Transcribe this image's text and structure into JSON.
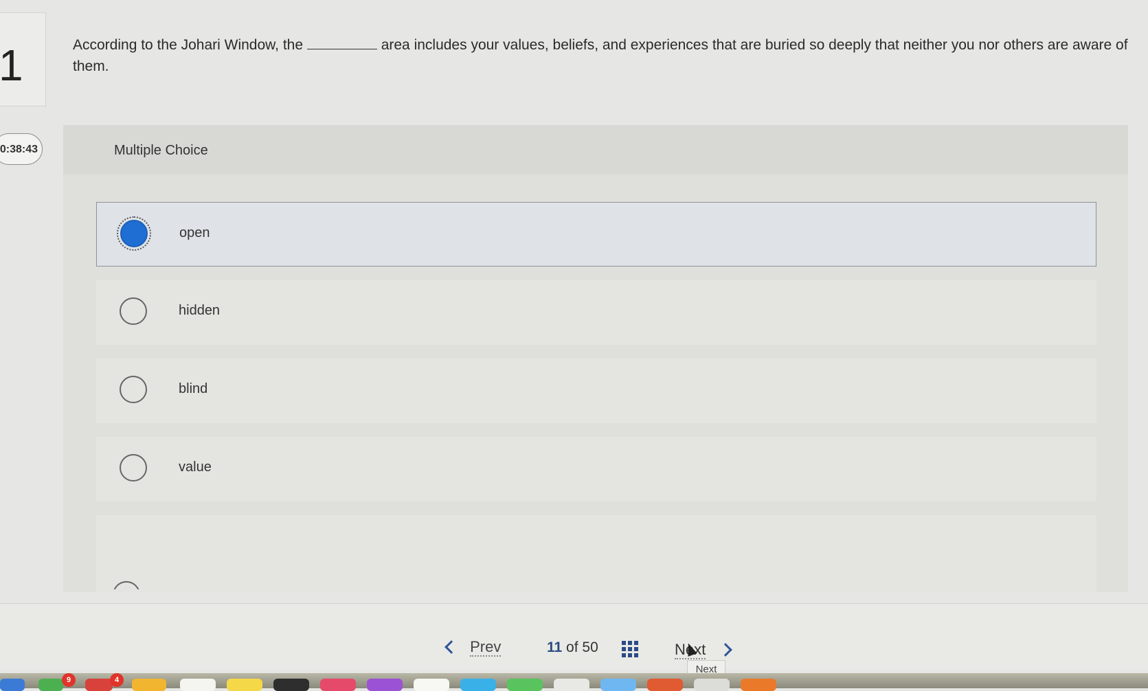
{
  "question": {
    "number": "1",
    "text_before": "According to the Johari Window, the",
    "text_after": "area includes your values, beliefs, and experiences that are buried so deeply that neither you nor others are aware of them."
  },
  "timer": "0:38:43",
  "question_type": "Multiple Choice",
  "options": [
    {
      "label": "open",
      "selected": true
    },
    {
      "label": "hidden",
      "selected": false
    },
    {
      "label": "blind",
      "selected": false
    },
    {
      "label": "value",
      "selected": false
    }
  ],
  "nav": {
    "prev_label": "Prev",
    "current_page": "11",
    "of_label": "of",
    "total_pages": "50",
    "next_label": "Next",
    "tooltip": "Next"
  },
  "dock": {
    "badge_1": "9",
    "badge_2": "4"
  },
  "colors": {
    "selected_radio": "#1f6ed4",
    "nav_accent": "#2b4a86"
  }
}
